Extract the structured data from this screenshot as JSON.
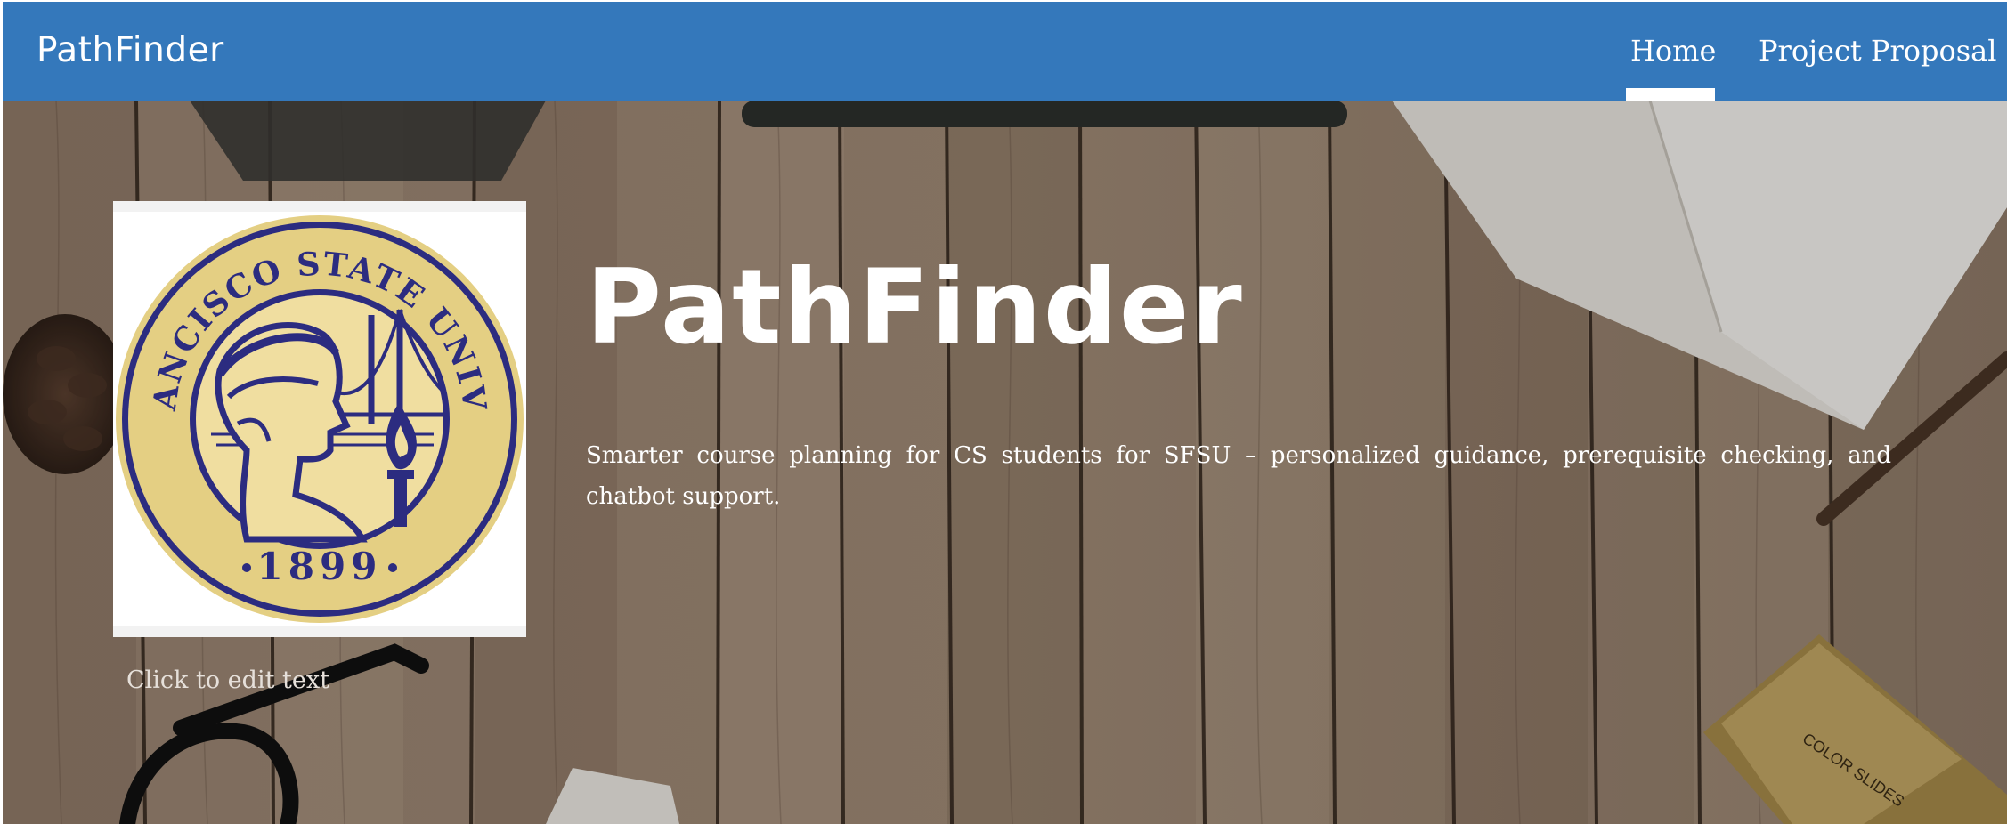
{
  "navbar": {
    "brand": "PathFinder",
    "links": [
      {
        "label": "Home",
        "active": true
      },
      {
        "label": "Project Proposal",
        "active": false
      }
    ],
    "background_color": "#3478bb"
  },
  "hero": {
    "image": {
      "seal_top_text": "SAN FRANCISCO STATE UNIVERSITY",
      "seal_year": "1899",
      "colors": {
        "navy": "#2c2c80",
        "gold": "#e4cf83",
        "cream": "#f0dea0"
      }
    },
    "image_caption": "Click to edit text",
    "title": "PathFinder",
    "tagline": "Smarter course planning for CS students for SFSU – personalized guidance, prerequisite checking, and chatbot support."
  }
}
